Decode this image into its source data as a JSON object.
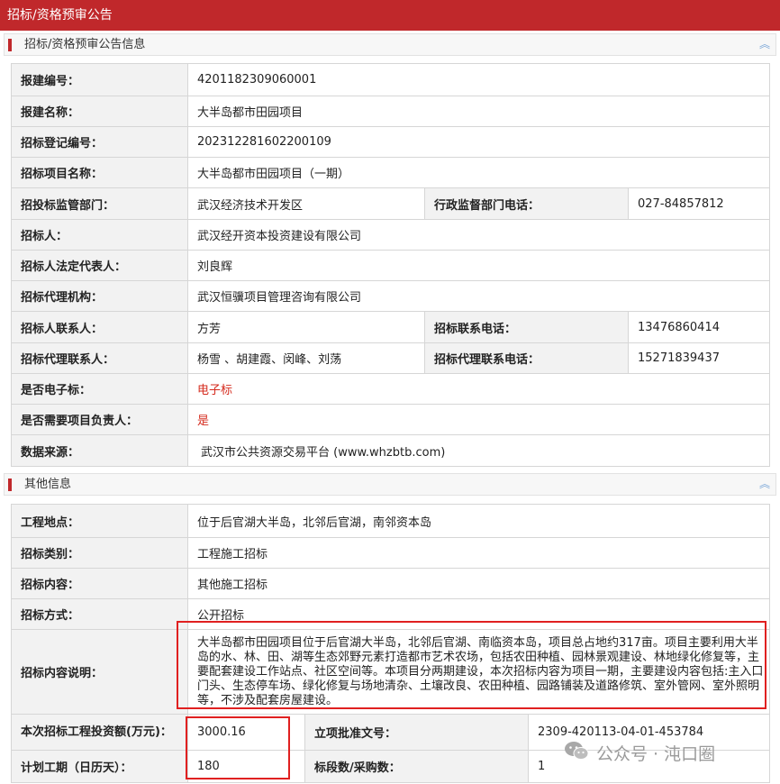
{
  "page_title": "招标/资格预审公告",
  "sections": {
    "info_title": "招标/资格预审公告信息",
    "other_title": "其他信息",
    "collapse_glyph": "︽"
  },
  "info": {
    "bid_number_label": "报建编号：",
    "bid_number": "4201182309060001",
    "bid_name_label": "报建名称：",
    "bid_name": "大半岛都市田园项目",
    "reg_no_label": "招标登记编号：",
    "reg_no": "202312281602200109",
    "project_name_label": "招标项目名称：",
    "project_name": "大半岛都市田园项目（一期）",
    "supervisor_label": "招投标监管部门：",
    "supervisor": "武汉经济技术开发区",
    "admin_phone_label": "行政监督部门电话：",
    "admin_phone": "027-84857812",
    "tenderer_label": "招标人：",
    "tenderer": "武汉经开资本投资建设有限公司",
    "legal_rep_label": "招标人法定代表人：",
    "legal_rep": "刘良辉",
    "agency_label": "招标代理机构：",
    "agency": "武汉恒骥项目管理咨询有限公司",
    "contact_label": "招标人联系人：",
    "contact": "方芳",
    "contact_phone_label": "招标联系电话：",
    "contact_phone": "13476860414",
    "agency_contact_label": "招标代理联系人：",
    "agency_contact": "杨雪 、胡建霞、闵峰、刘荡",
    "agency_phone_label": "招标代理联系电话：",
    "agency_phone": "15271839437",
    "electronic_label": "是否电子标：",
    "electronic": "电子标",
    "need_manager_label": "是否需要项目负责人：",
    "need_manager": "是",
    "source_label": "数据来源：",
    "source": "武汉市公共资源交易平台 (www.whzbtb.com)"
  },
  "other": {
    "location_label": "工程地点：",
    "location": "位于后官湖大半岛，北邻后官湖，南邻资本岛",
    "category_label": "招标类别：",
    "category": "工程施工招标",
    "content_label": "招标内容：",
    "content": "其他施工招标",
    "method_label": "招标方式：",
    "method": "公开招标",
    "desc_label": "招标内容说明：",
    "desc": "大半岛都市田园项目位于后官湖大半岛，北邻后官湖、南临资本岛，项目总占地约317亩。项目主要利用大半岛的水、林、田、湖等生态郊野元素打造都市艺术农场，包括农田种植、园林景观建设、林地绿化修复等，主要配套建设工作站点、社区空间等。本项目分两期建设，本次招标内容为项目一期，主要建设内容包括:主入口门头、生态停车场、绿化修复与场地清杂、土壤改良、农田种植、园路铺装及道路修筑、室外管网、室外照明等，不涉及配套房屋建设。",
    "investment_label": "本次招标工程投资额(万元)：",
    "investment": "3000.16",
    "approval_label": "立项批准文号：",
    "approval": "2309-420113-04-01-453784",
    "duration_label": "计划工期（日历天）：",
    "duration": "180",
    "sections_label": "标段数/采购数：",
    "sections_count": "1"
  },
  "watermark": {
    "text": "公众号 · 沌口圈",
    "icon": "wechat-icon"
  },
  "colors": {
    "brand_red": "#c0282b",
    "highlight_red": "#e02020",
    "label_bg": "#f2f2f2"
  }
}
